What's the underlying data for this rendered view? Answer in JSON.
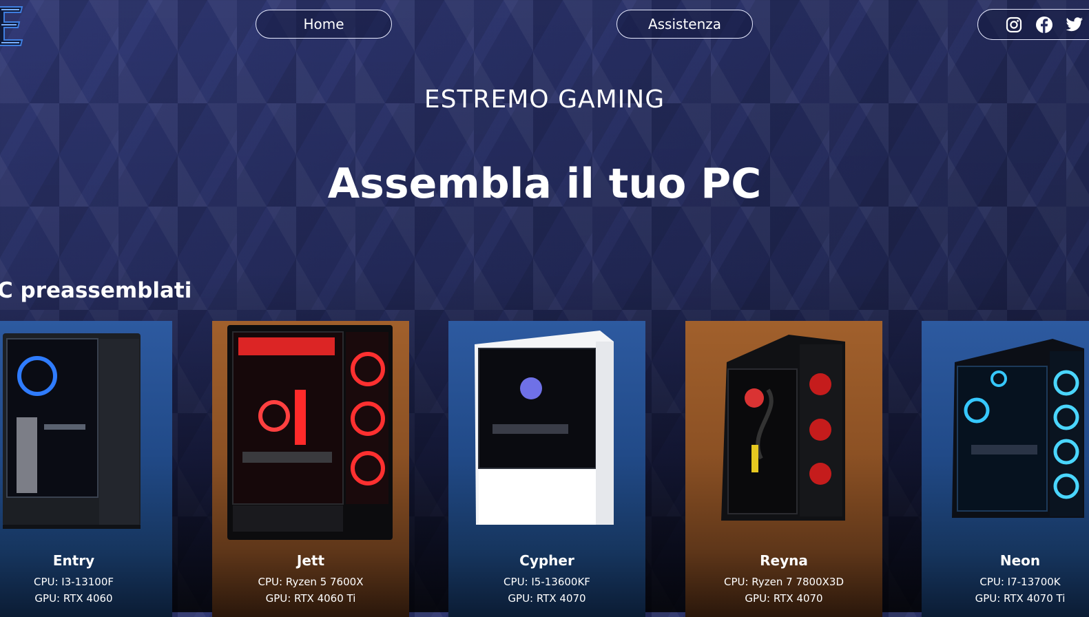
{
  "nav": {
    "home_label": "Home",
    "support_label": "Assistenza"
  },
  "social": [
    "instagram-icon",
    "facebook-icon",
    "twitter-icon"
  ],
  "hero": {
    "brand": "ESTREMO GAMING",
    "headline": "Assembla il tuo PC"
  },
  "section": {
    "title": "C preassemblati"
  },
  "products": [
    {
      "name": "Entry",
      "cpu": "CPU: I3-13100F",
      "gpu": "GPU: RTX 4060",
      "theme": "blue"
    },
    {
      "name": "Jett",
      "cpu": "CPU: Ryzen 5 7600X",
      "gpu": "GPU: RTX 4060 Ti",
      "theme": "orange"
    },
    {
      "name": "Cypher",
      "cpu": "CPU: I5-13600KF",
      "gpu": "GPU: RTX 4070",
      "theme": "blue"
    },
    {
      "name": "Reyna",
      "cpu": "CPU: Ryzen 7 7800X3D",
      "gpu": "GPU: RTX 4070",
      "theme": "orange"
    },
    {
      "name": "Neon",
      "cpu": "CPU: I7-13700K",
      "gpu": "GPU: RTX 4070 Ti",
      "theme": "blue"
    }
  ],
  "colors": {
    "card_blue": "#2d5aa0",
    "card_orange": "#a1602c",
    "background": "#262d60"
  }
}
